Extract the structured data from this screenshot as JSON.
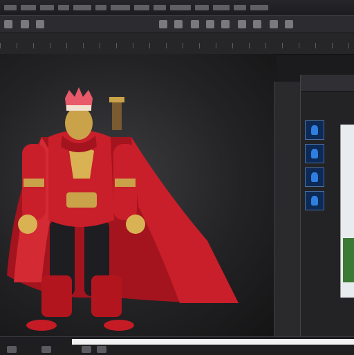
{
  "menu": {
    "item_count": 14
  },
  "toolbar": {
    "tools": [
      "file-icon",
      "folder-icon",
      "save-icon",
      "undo-icon",
      "redo-icon",
      "select-icon",
      "move-icon",
      "rotate-icon",
      "scale-icon",
      "camera-icon",
      "grid-icon",
      "render-icon"
    ]
  },
  "viewport": {
    "subject": "3d-character-model"
  },
  "panels": {
    "thumbnails": 4
  },
  "statusbar": {
    "text": ""
  },
  "colors": {
    "accent": "#2f7fe0",
    "cape": "#c81f2a",
    "gold": "#caa24a",
    "panel_bg": "#232326"
  }
}
